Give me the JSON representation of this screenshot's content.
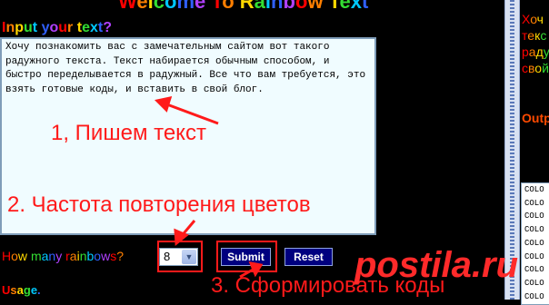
{
  "app": {
    "title": "Welcome To Rainbow Text",
    "input_label": "Input your text?",
    "text_value": "Хочу познакомить вас с замечательным сайтом вот такого радужного текста. Текст набирается обычным способом, и быстро переделывается в радужный. Все что вам требуется, это взять готовые коды, и вставить в свой блог.",
    "rainbows_label": "How many rainbows?",
    "rainbows_value": "8",
    "submit_label": "Submit",
    "reset_label": "Reset",
    "usage_label": "Usage."
  },
  "right_panel": {
    "preview_lines": [
      "Хоч",
      "текс",
      "радуж",
      "свой"
    ],
    "output_label": "Outp",
    "output_lines": [
      "COLO",
      "COLO",
      "COLO",
      "COLO",
      "COLO",
      "COLO",
      "COLO",
      "COLO",
      "COLO"
    ]
  },
  "annotations": {
    "step1": "1, Пишем текст",
    "step2": "2. Частота повторения цветов",
    "step3": "3. Сформировать коды"
  },
  "watermark": "postila.ru",
  "colors": {
    "background": "#000000",
    "annotation_red": "#ff1a1a",
    "button_blue": "#00007f",
    "textarea_bg": "#f0fcff"
  }
}
